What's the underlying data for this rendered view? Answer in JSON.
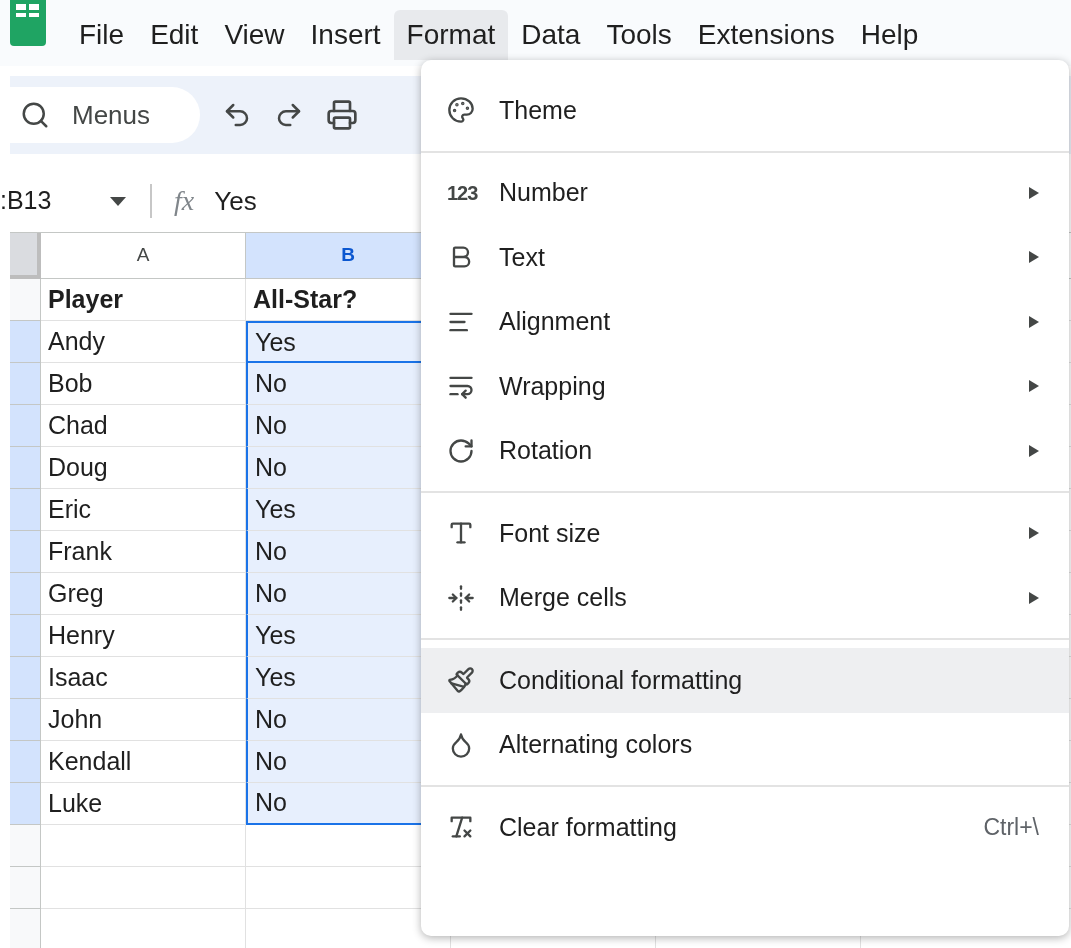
{
  "menu_bar": [
    {
      "label": "File",
      "selected": false
    },
    {
      "label": "Edit",
      "selected": false
    },
    {
      "label": "View",
      "selected": false
    },
    {
      "label": "Insert",
      "selected": false
    },
    {
      "label": "Format",
      "selected": true
    },
    {
      "label": "Data",
      "selected": false
    },
    {
      "label": "Tools",
      "selected": false
    },
    {
      "label": "Extensions",
      "selected": false
    },
    {
      "label": "Help",
      "selected": false
    }
  ],
  "toolbar": {
    "search": {
      "placeholder": "Menus"
    }
  },
  "formula_bar": {
    "name_box": ":B13",
    "function_glyph": "fx",
    "formula": "Yes"
  },
  "columns": [
    {
      "label": "A",
      "selected": false
    },
    {
      "label": "B",
      "selected": true
    }
  ],
  "rows": [
    {
      "cells": [
        {
          "text": "Player",
          "bold": true,
          "selected": false
        },
        {
          "text": "All-Star?",
          "bold": true,
          "selected": false
        }
      ],
      "selected": false
    },
    {
      "cells": [
        {
          "text": "Andy",
          "bold": false,
          "selected": false
        },
        {
          "text": "Yes",
          "bold": false,
          "selected": true
        }
      ],
      "selected": true
    },
    {
      "cells": [
        {
          "text": "Bob",
          "bold": false,
          "selected": false
        },
        {
          "text": "No",
          "bold": false,
          "selected": true
        }
      ],
      "selected": true
    },
    {
      "cells": [
        {
          "text": "Chad",
          "bold": false,
          "selected": false
        },
        {
          "text": "No",
          "bold": false,
          "selected": true
        }
      ],
      "selected": true
    },
    {
      "cells": [
        {
          "text": "Doug",
          "bold": false,
          "selected": false
        },
        {
          "text": "No",
          "bold": false,
          "selected": true
        }
      ],
      "selected": true
    },
    {
      "cells": [
        {
          "text": "Eric",
          "bold": false,
          "selected": false
        },
        {
          "text": "Yes",
          "bold": false,
          "selected": true
        }
      ],
      "selected": true
    },
    {
      "cells": [
        {
          "text": "Frank",
          "bold": false,
          "selected": false
        },
        {
          "text": "No",
          "bold": false,
          "selected": true
        }
      ],
      "selected": true
    },
    {
      "cells": [
        {
          "text": "Greg",
          "bold": false,
          "selected": false
        },
        {
          "text": "No",
          "bold": false,
          "selected": true
        }
      ],
      "selected": true
    },
    {
      "cells": [
        {
          "text": "Henry",
          "bold": false,
          "selected": false
        },
        {
          "text": "Yes",
          "bold": false,
          "selected": true
        }
      ],
      "selected": true
    },
    {
      "cells": [
        {
          "text": "Isaac",
          "bold": false,
          "selected": false
        },
        {
          "text": "Yes",
          "bold": false,
          "selected": true
        }
      ],
      "selected": true
    },
    {
      "cells": [
        {
          "text": "John",
          "bold": false,
          "selected": false
        },
        {
          "text": "No",
          "bold": false,
          "selected": true
        }
      ],
      "selected": true
    },
    {
      "cells": [
        {
          "text": "Kendall",
          "bold": false,
          "selected": false
        },
        {
          "text": "No",
          "bold": false,
          "selected": true
        }
      ],
      "selected": true
    },
    {
      "cells": [
        {
          "text": "Luke",
          "bold": false,
          "selected": false
        },
        {
          "text": "No",
          "bold": false,
          "selected": true
        }
      ],
      "selected": true
    }
  ],
  "format_menu": {
    "sections": [
      [
        {
          "kind": "theme",
          "label": "Theme",
          "submenu": false,
          "selected": false
        }
      ],
      [
        {
          "kind": "number",
          "glyph": "123",
          "label": "Number",
          "submenu": true,
          "selected": false
        },
        {
          "kind": "text",
          "label": "Text",
          "submenu": true,
          "selected": false
        },
        {
          "kind": "alignment",
          "label": "Alignment",
          "submenu": true,
          "selected": false
        },
        {
          "kind": "wrapping",
          "label": "Wrapping",
          "submenu": true,
          "selected": false
        },
        {
          "kind": "rotation",
          "label": "Rotation",
          "submenu": true,
          "selected": false
        }
      ],
      [
        {
          "kind": "font_size",
          "label": "Font size",
          "submenu": true,
          "selected": false
        },
        {
          "kind": "merge",
          "label": "Merge cells",
          "submenu": true,
          "selected": false
        }
      ],
      [
        {
          "kind": "conditional",
          "label": "Conditional formatting",
          "submenu": false,
          "selected": true
        },
        {
          "kind": "alternating",
          "label": "Alternating colors",
          "submenu": false,
          "selected": false
        }
      ],
      [
        {
          "kind": "clear",
          "label": "Clear formatting",
          "submenu": false,
          "selected": false,
          "shortcut": "Ctrl+\\"
        }
      ]
    ]
  }
}
